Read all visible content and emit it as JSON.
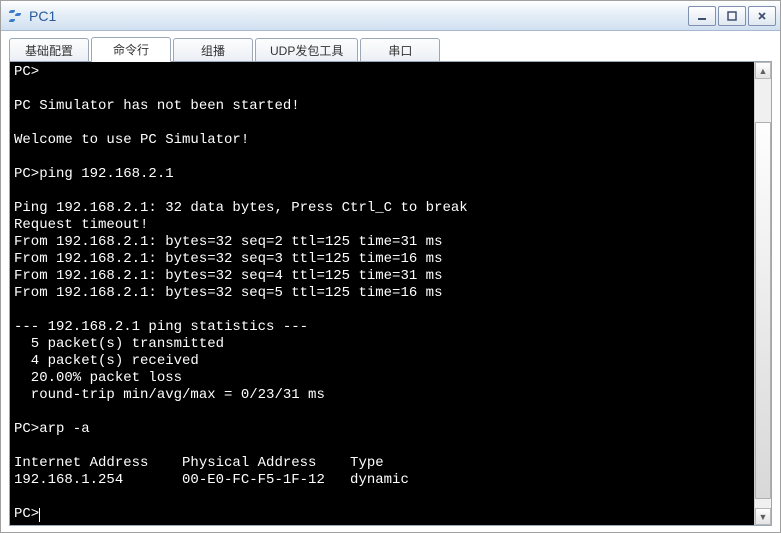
{
  "window": {
    "title": "PC1"
  },
  "tabs": [
    {
      "label": "基础配置"
    },
    {
      "label": "命令行"
    },
    {
      "label": "组播"
    },
    {
      "label": "UDP发包工具"
    },
    {
      "label": "串口"
    }
  ],
  "terminal": {
    "lines": [
      "PC>",
      "",
      "PC Simulator has not been started!",
      "",
      "Welcome to use PC Simulator!",
      "",
      "PC>ping 192.168.2.1",
      "",
      "Ping 192.168.2.1: 32 data bytes, Press Ctrl_C to break",
      "Request timeout!",
      "From 192.168.2.1: bytes=32 seq=2 ttl=125 time=31 ms",
      "From 192.168.2.1: bytes=32 seq=3 ttl=125 time=16 ms",
      "From 192.168.2.1: bytes=32 seq=4 ttl=125 time=31 ms",
      "From 192.168.2.1: bytes=32 seq=5 ttl=125 time=16 ms",
      "",
      "--- 192.168.2.1 ping statistics ---",
      "  5 packet(s) transmitted",
      "  4 packet(s) received",
      "  20.00% packet loss",
      "  round-trip min/avg/max = 0/23/31 ms",
      "",
      "PC>arp -a",
      "",
      "Internet Address    Physical Address    Type",
      "192.168.1.254       00-E0-FC-F5-1F-12   dynamic",
      "",
      "PC>"
    ]
  },
  "scroll": {
    "thumb_top_pct": 10,
    "thumb_height_pct": 88
  }
}
